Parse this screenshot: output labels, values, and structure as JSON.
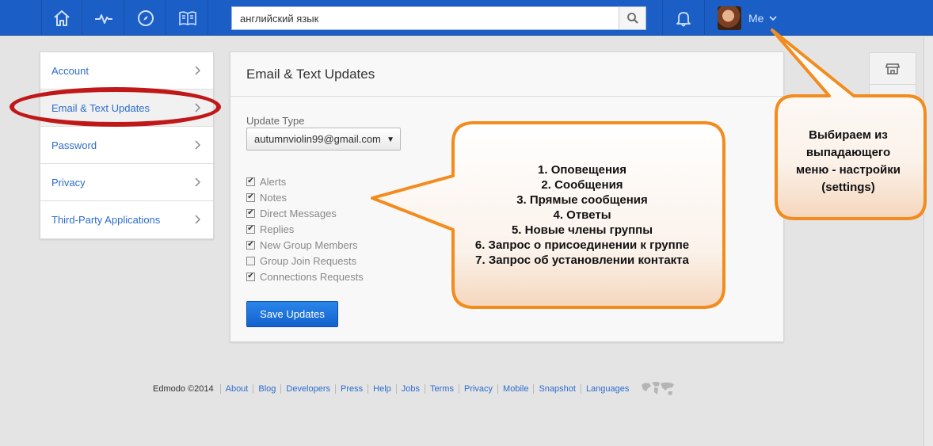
{
  "topbar": {
    "search_value": "английский язык",
    "me_label": "Me",
    "nav_icons": [
      "home-icon",
      "activity-icon",
      "compass-icon",
      "book-icon"
    ],
    "color": "#1b5fc6"
  },
  "sidebar": {
    "items": [
      {
        "label": "Account"
      },
      {
        "label": "Email & Text Updates"
      },
      {
        "label": "Password"
      },
      {
        "label": "Privacy"
      },
      {
        "label": "Third-Party Applications"
      }
    ]
  },
  "panel": {
    "title": "Email & Text Updates",
    "update_type_label": "Update Type",
    "selected_email": "autumnviolin99@gmail.com",
    "checkboxes": [
      {
        "label": "Alerts",
        "checked": true
      },
      {
        "label": "Notes",
        "checked": true
      },
      {
        "label": "Direct Messages",
        "checked": true
      },
      {
        "label": "Replies",
        "checked": true
      },
      {
        "label": "New Group Members",
        "checked": true
      },
      {
        "label": "Group Join Requests",
        "checked": false
      },
      {
        "label": "Connections Requests",
        "checked": true
      }
    ],
    "save_label": "Save Updates"
  },
  "annotations": {
    "list_lines": [
      "1. Оповещения",
      "2. Сообщения",
      "3. Прямые сообщения",
      "4. Ответы",
      "5. Новые члены группы",
      "6. Запрос о присоединении к группе",
      "7. Запрос об установлении контакта"
    ],
    "menu_lines": [
      "Выбираем из",
      "выпадающего",
      "меню - настройки",
      "(settings)"
    ],
    "callout_color": "#f28c1e",
    "oval_color": "#c01818"
  },
  "footer": {
    "copyright": "Edmodo ©2014",
    "links": [
      "About",
      "Blog",
      "Developers",
      "Press",
      "Help",
      "Jobs",
      "Terms",
      "Privacy",
      "Mobile",
      "Snapshot",
      "Languages"
    ]
  }
}
